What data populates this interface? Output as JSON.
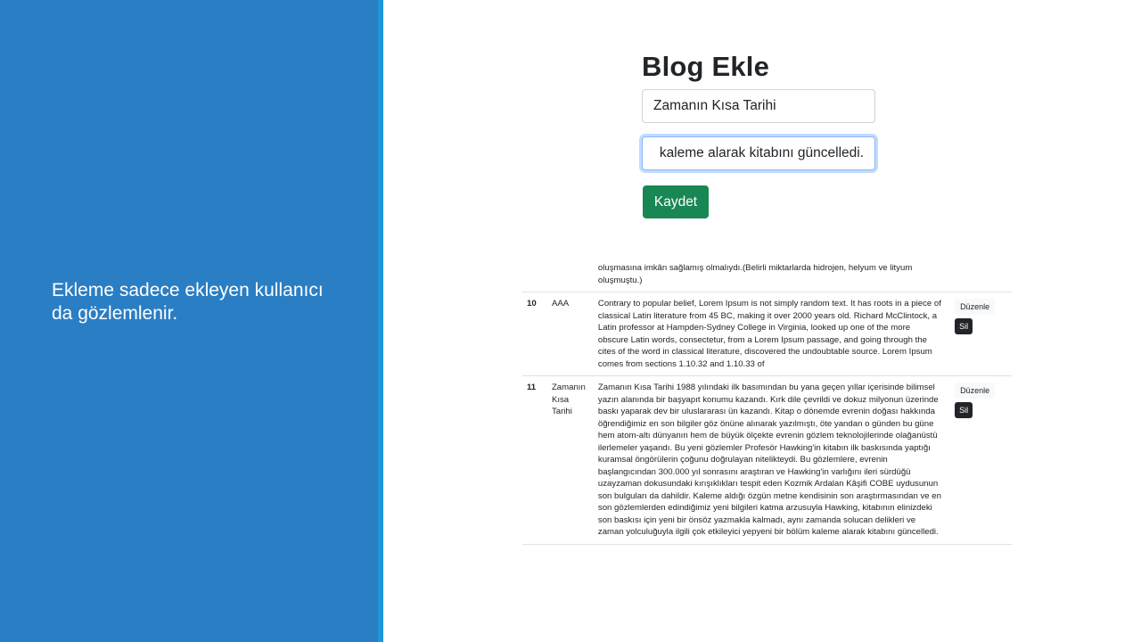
{
  "slide": {
    "caption": "Ekleme sadece ekleyen kullanıcı da gözlemlenir."
  },
  "form": {
    "heading": "Blog Ekle",
    "title_value": "Zamanın Kısa Tarihi",
    "content_value": "kaleme alarak kitabını güncelledi.",
    "save_label": "Kaydet"
  },
  "table": {
    "previous_row_tail": "oluşmasına imkân sağlamış olmalıydı.(Belirli miktarlarda hidrojen, helyum ve lityum oluşmuştu.)",
    "rows": [
      {
        "id": "10",
        "title": "AAA",
        "content": "Contrary to popular belief, Lorem Ipsum is not simply random text. It has roots in a piece of classical Latin literature from 45 BC, making it over 2000 years old. Richard McClintock, a Latin professor at Hampden-Sydney College in Virginia, looked up one of the more obscure Latin words, consectetur, from a Lorem Ipsum passage, and going through the cites of the word in classical literature, discovered the undoubtable source. Lorem Ipsum comes from sections 1.10.32 and 1.10.33 of",
        "edit_label": "Düzenle",
        "delete_label": "Sil"
      },
      {
        "id": "11",
        "title": "Zamanın Kısa Tarihi",
        "content": "Zamanın Kısa Tarihi 1988 yılındaki ilk basımından bu yana geçen yıllar içerisinde bilimsel yazın alanında bir başyapıt konumu kazandı. Kırk dile çevrildi ve dokuz milyonun üzerinde baskı yaparak dev bir uluslararası ün kazandı. Kitap o dönemde evrenin doğası hakkında öğrendiğimiz en son bilgiler göz önüne alınarak yazılmıştı, öte yandan o günden bu güne hem atom-altı dünyanın hem de büyük ölçekte evrenin gözlem teknolojilerinde olağanüstü ilerlemeler yaşandı. Bu yeni gözlemler Profesör Hawking'in kitabın ilk baskısında yaptığı kuramsal öngörülerin çoğunu doğrulayan nitelikteydi. Bu gözlemlere, evrenin başlangıcından 300.000 yıl sonrasını araştıran ve Hawking'in varlığını ileri sürdüğü uzayzaman dokusundaki kırışıklıkları tespit eden Kozmik Ardalan Kâşifi COBE uydusunun son bulguları da dahildir. Kaleme aldığı özgün metne kendisinin son araştırmasından ve en son gözlemlerden edindiğimiz yeni bilgileri katma arzusuyla Hawking, kitabının elinizdeki son baskısı için yeni bir önsöz yazmakla kalmadı, aynı zamanda solucan delikleri ve zaman yolculuğuyla ilgili çok etkileyici yepyeni bir bölüm kaleme alarak kitabını güncelledi.",
        "edit_label": "Düzenle",
        "delete_label": "Sil"
      }
    ]
  }
}
